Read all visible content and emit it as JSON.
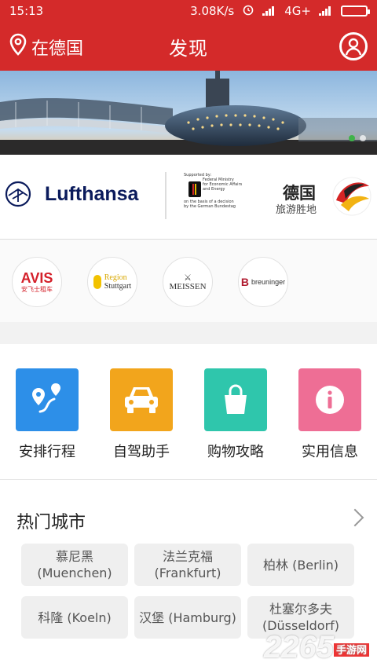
{
  "status": {
    "time": "15:13",
    "speed": "3.08K/s",
    "network": "4G+"
  },
  "header": {
    "location": "在德国",
    "title": "发现"
  },
  "banner": {
    "dots": 2,
    "active_dot": 1
  },
  "sponsors": {
    "lufthansa": "Lufthansa",
    "ministry_lines": [
      "Supported by:",
      "Federal Ministry",
      "for Economic Affairs",
      "and Energy",
      "",
      "on the basis of a decision",
      "by the German Bundestag"
    ],
    "germany_title": "德国",
    "germany_sub": "旅游胜地"
  },
  "partners": [
    {
      "name": "AVIS",
      "sub": "安飞士租车"
    },
    {
      "name": "Region",
      "sub": "Stuttgart"
    },
    {
      "name": "MEISSEN",
      "sub": ""
    },
    {
      "name": "breuninger",
      "sub": ""
    }
  ],
  "features": [
    {
      "label": "安排行程",
      "color": "#2d8fe8"
    },
    {
      "label": "自驾助手",
      "color": "#f2a51c"
    },
    {
      "label": "购物攻略",
      "color": "#2fc6ac"
    },
    {
      "label": "实用信息",
      "color": "#ee6e95"
    }
  ],
  "hot": {
    "title": "热门城市",
    "cities": [
      {
        "l1": "慕尼黑",
        "l2": "(Muenchen)"
      },
      {
        "l1": "法兰克福",
        "l2": "(Frankfurt)"
      },
      {
        "l1": "柏林 (Berlin)",
        "l2": ""
      },
      {
        "l1": "科隆 (Koeln)",
        "l2": ""
      },
      {
        "l1": "汉堡 (Hamburg)",
        "l2": ""
      },
      {
        "l1": "杜塞尔多夫",
        "l2": "(Düsseldorf)"
      }
    ]
  },
  "watermark": {
    "text": "2265",
    "sub": "手游网"
  },
  "colors": {
    "brand_red": "#d42a2a",
    "active_dot": "#3fb34a"
  }
}
